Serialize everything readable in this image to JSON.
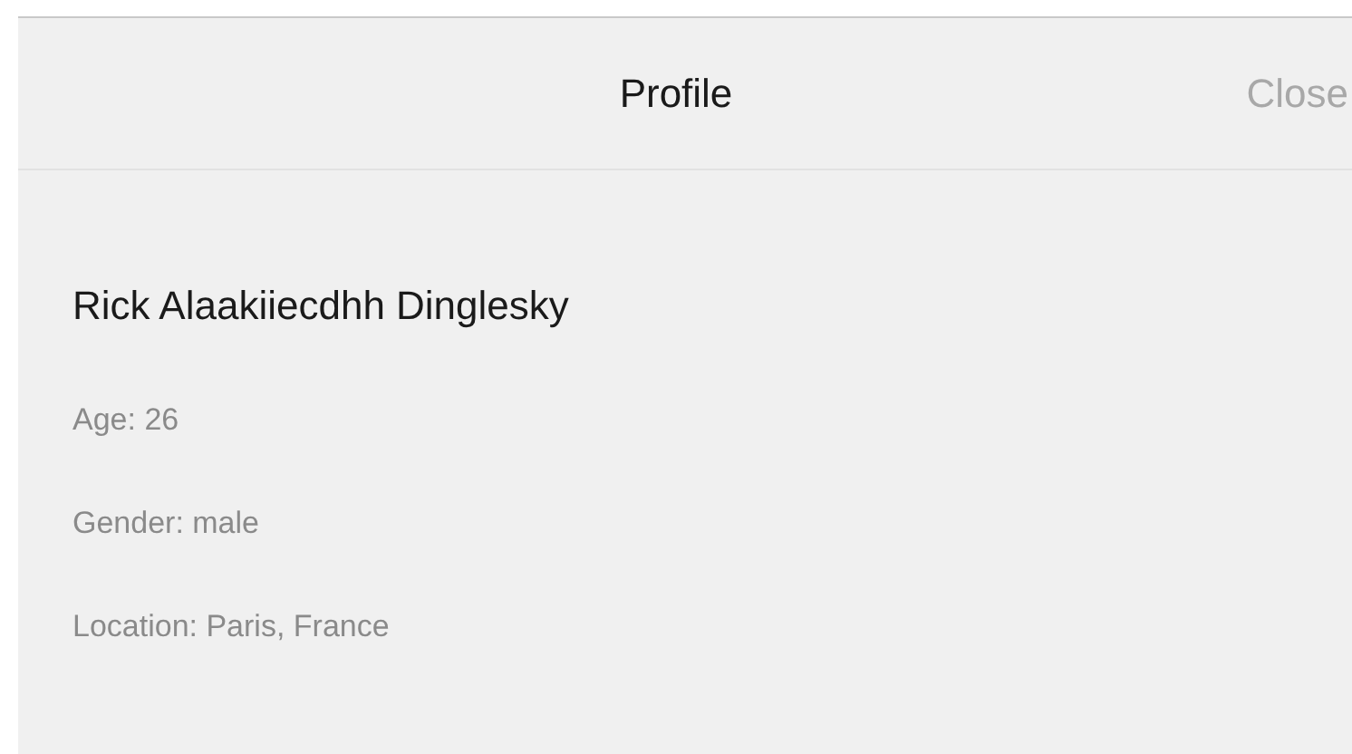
{
  "header": {
    "title": "Profile",
    "close": {
      "label": "Close",
      "disabled": true
    }
  },
  "profile": {
    "name": "Rick Alaakiiecdhh Dinglesky",
    "details": [
      "Age: 26",
      "Gender: male",
      "Location: Paris, France"
    ]
  }
}
